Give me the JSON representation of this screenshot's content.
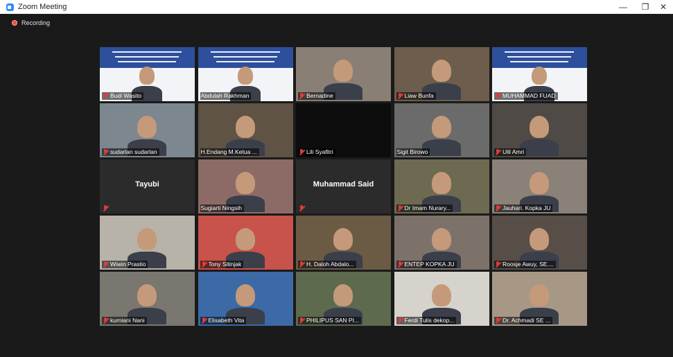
{
  "window": {
    "title": "Zoom Meeting",
    "controls": [
      "minimize-icon",
      "restore-icon",
      "close-icon"
    ]
  },
  "recording": {
    "label": "Recording"
  },
  "participants": [
    {
      "name": "Budi Wasito",
      "muted": true,
      "kind": "slide"
    },
    {
      "name": "Abdulah Rakhman",
      "muted": false,
      "kind": "slide",
      "active": true
    },
    {
      "name": "Bernadine",
      "muted": true,
      "kind": "video"
    },
    {
      "name": "Liaw Bunfa",
      "muted": true,
      "kind": "video"
    },
    {
      "name": "MUHAMMAD FUAD",
      "muted": true,
      "kind": "slide"
    },
    {
      "name": "sudarlan sudarlan",
      "muted": true,
      "kind": "video"
    },
    {
      "name": "H.Endang M.Ketua ...",
      "muted": false,
      "kind": "video"
    },
    {
      "name": "Lili Syafitri",
      "muted": true,
      "kind": "dark"
    },
    {
      "name": "Sigit Birowo",
      "muted": false,
      "kind": "video"
    },
    {
      "name": "Ulil Amri",
      "muted": true,
      "kind": "video"
    },
    {
      "name": "Tayubi",
      "muted": true,
      "kind": "nameonly"
    },
    {
      "name": "Sugiarti Ningsih",
      "muted": false,
      "kind": "video"
    },
    {
      "name": "Muhammad Said",
      "muted": true,
      "kind": "nameonly"
    },
    {
      "name": "Dr Imam Nurary...",
      "muted": true,
      "kind": "video"
    },
    {
      "name": "Jauhari. Kopka JU",
      "muted": true,
      "kind": "video"
    },
    {
      "name": "Wiwin Prastio",
      "muted": true,
      "kind": "video"
    },
    {
      "name": "Tony Sitinjak",
      "muted": true,
      "kind": "video"
    },
    {
      "name": "H. Daloh Abdalo...",
      "muted": true,
      "kind": "video"
    },
    {
      "name": "ENTEP KOPKA JU",
      "muted": true,
      "kind": "video"
    },
    {
      "name": "Roosje Awuy, SE....",
      "muted": true,
      "kind": "video"
    },
    {
      "name": "kurniani Nani",
      "muted": true,
      "kind": "video"
    },
    {
      "name": "Elisabeth Vita",
      "muted": true,
      "kind": "video"
    },
    {
      "name": "PHILIPUS SAN PI...",
      "muted": true,
      "kind": "video"
    },
    {
      "name": "Ferdi Tulis dekop...",
      "muted": true,
      "kind": "video"
    },
    {
      "name": "Dr. Achmadi SE ...",
      "muted": true,
      "kind": "video"
    }
  ]
}
